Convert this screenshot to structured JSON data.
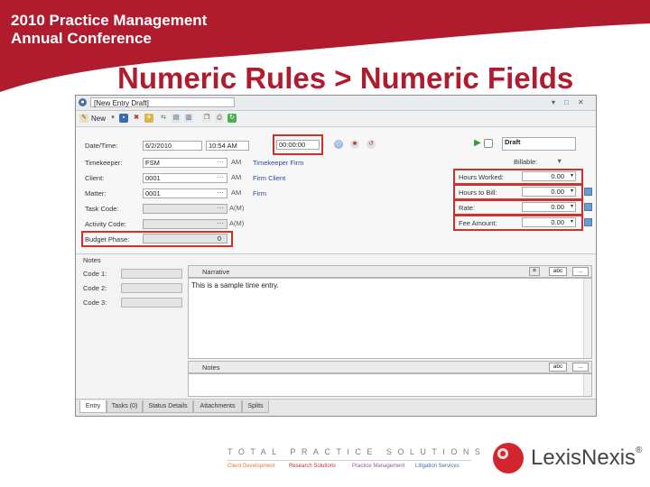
{
  "header": {
    "conference_line1": "2010 Practice Management",
    "conference_line2": "Annual Conference",
    "slide_title": "Numeric Rules > Numeric Fields",
    "brand_color": "#b01c2e"
  },
  "window": {
    "title": "[New Entry Draft]",
    "toolbar": {
      "new_label": "New"
    }
  },
  "form": {
    "date_time_label": "Date/Time:",
    "date_value": "6/2/2010",
    "time_value": "10:54 AM",
    "timer_value": "00:00:00",
    "draft_label": "Draft",
    "billable_label": "Billable:",
    "timekeeper_label": "Timekeeper:",
    "timekeeper_value": "FSM",
    "timekeeper_code": "AM",
    "timekeeper_link": "Timekeeper Firm",
    "client_label": "Client:",
    "client_value": "0001",
    "client_code": "AM",
    "client_link": "Firm Client",
    "matter_label": "Matter:",
    "matter_value": "0001",
    "matter_code": "AM",
    "matter_link": "Firm",
    "task_label": "Task Code:",
    "task_code": "A(M)",
    "activity_label": "Activity Code:",
    "activity_code": "A(M)",
    "budget_label": "Budget Phase:",
    "budget_value": "0",
    "hours_worked_label": "Hours Worked:",
    "hours_worked_value": "0.00",
    "hours_bill_label": "Hours to Bill:",
    "hours_bill_value": "0.00",
    "rate_label": "Rate:",
    "rate_value": "0.00",
    "fee_label": "Fee Amount:",
    "fee_value": "0.00",
    "highlight_color": "#d0312d"
  },
  "lower": {
    "notes_label": "Notes",
    "code1_label": "Code 1:",
    "code2_label": "Code 2:",
    "code3_label": "Code 3:",
    "narrative_label": "Narrative",
    "narrative_text": "This is a sample time entry.",
    "notes2_label": "Notes",
    "abc_label": "abc",
    "more_label": "..."
  },
  "tabs": [
    "Entry",
    "Tasks (0)",
    "Status Details",
    "Attachments",
    "Splits"
  ],
  "footer": {
    "tagline": "TOTAL PRACTICE SOLUTIONS",
    "sub1": "Client Development",
    "sub2": "Research Solutions",
    "sub3": "Practice Management",
    "sub4": "Litigation Services",
    "brand": "LexisNexis",
    "brand_mark": "®"
  }
}
